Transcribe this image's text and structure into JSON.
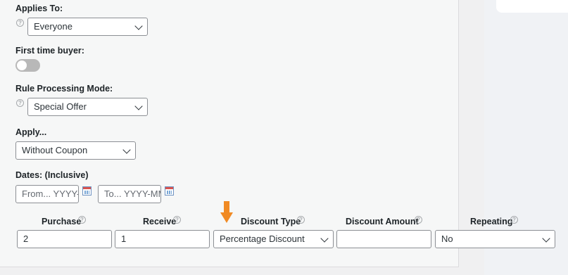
{
  "form": {
    "applies_to": {
      "label": "Applies To:",
      "value": "Everyone"
    },
    "first_time_buyer": {
      "label": "First time buyer:",
      "enabled": false
    },
    "rule_processing_mode": {
      "label": "Rule Processing Mode:",
      "value": "Special Offer"
    },
    "apply": {
      "label": "Apply...",
      "value": "Without Coupon"
    },
    "dates": {
      "label": "Dates: (Inclusive)",
      "from_placeholder": "From... YYYY-",
      "to_placeholder": "To... YYYY-MM"
    }
  },
  "table": {
    "headers": {
      "purchase": "Purchase",
      "receive": "Receive",
      "discount_type": "Discount Type",
      "discount_amount": "Discount Amount",
      "repeating": "Repeating"
    },
    "row": {
      "purchase": "2",
      "receive": "1",
      "discount_type": "Percentage Discount",
      "discount_amount": "",
      "repeating": "No"
    }
  },
  "colors": {
    "accent_arrow": "#f08a24",
    "toggle_off": "#b8b8b8"
  },
  "icons": {
    "help": "question-circle-icon",
    "calendar": "calendar-icon",
    "chevron": "chevron-down-icon"
  }
}
